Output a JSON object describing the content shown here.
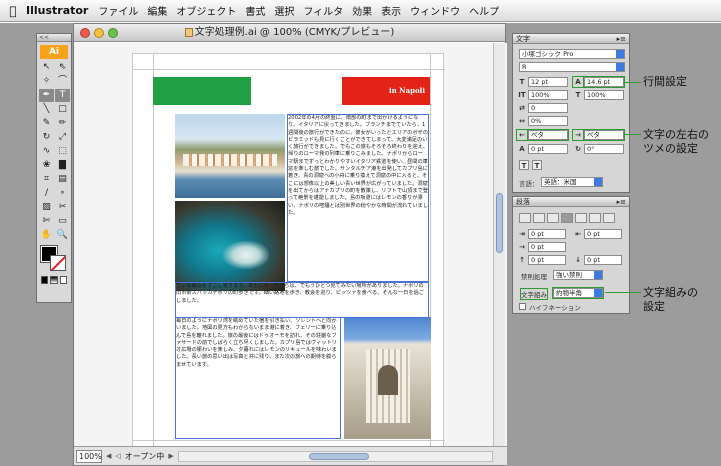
{
  "menubar": {
    "app_name": "Illustrator",
    "items": [
      "ファイル",
      "編集",
      "オブジェクト",
      "書式",
      "選択",
      "フィルタ",
      "効果",
      "表示",
      "ウィンドウ",
      "ヘルプ"
    ]
  },
  "tools_panel": {
    "collapse_label": "<<",
    "logo": "Ai"
  },
  "document": {
    "title": "文字処理例.ai @ 100% (CMYK/プレビュー)",
    "zoom": "100%",
    "status": "オープン中",
    "banner_text": "in Napoli",
    "text_block_1": "2002年の4月の終盤に、南部の町まで出かけるようになり、イタリアに戻ってきました。ブランチまでていたら、1週間後の旅行ができたのに、彼女がいったとエリアのボザのピラミッドも見に行くことができてしまって、大変満足のいく旅行ができました。でもこの旅もそろそろ終わりを迎え、帰りのローマ発の列車に乗りこみました。ナポリからローマ駅までずっとわかりやすいイタリア鉄道を使い、昼間の車窓を楽しむ旅でした。サンタルチア港を出発してカプリ島に着き、青の洞窟への小舟に乗り換えて洞窟の中に入ると、そこには想像以上の美しい青い世界が広がっていました。洞窟を出てからはアナカプリの町を散策し、リフトで山頂まで登って絶景を堪能しました。島の坂道にはレモンの香りが漂い、ナポリの喧騒とは別世界の穏やかな時間が流れていました。",
    "text_block_2": "ている最近をすこし書きます。本土に戻ってからは、でもうひとつ見てみたい場所がありました。ナポリの旧市街スパッカナポリの町歩きです。細い路地を歩き、教会を巡り、ピッツァを食べる、そんな一日を過ごしました。",
    "text_block_3": "毎日のようにナポリ湾を眺めていた宿を引き払い、ソレントへと向かいました。地図の見方もわからないまま港に着き、フェリーに乗り込んで島を離れました。旅の最後にはドゥオーモを訪れ、その荘厳なファサードの前でしばらく立ち尽くしました。カプリ島ではヴィットリオ広場の賑わいを楽しみ、夕暮れにはレモンのリキュールを味わいました。長い旅の思い出は写真と共に残り、また次の旅への期待を膨らませています。"
  },
  "character_panel": {
    "title": "文字",
    "font_family": "小塚ゴシック Pro",
    "font_style": "R",
    "font_size": "12 pt",
    "leading": "14.6 pt",
    "vertical_scale": "100%",
    "horizontal_scale": "100%",
    "tracking": "0",
    "kerning": "0%",
    "aki_left": "ベタ",
    "aki_right": "ベタ",
    "baseline_shift": "0 pt",
    "rotation": "0°",
    "language_label": "言語：",
    "language": "英語：米国"
  },
  "paragraph_panel": {
    "title": "段落",
    "indent_left": "0 pt",
    "indent_right": "0 pt",
    "first_line": "0 pt",
    "space_before": "0 pt",
    "space_after": "0 pt",
    "kinsoku_label": "禁則処理",
    "kinsoku": "強い禁則",
    "mojikumi_label": "文字組み",
    "mojikumi": "約物半角",
    "hyphenation": "ハイフネーション"
  },
  "annotations": {
    "leading": "行間設定",
    "tsume": "文字の左右の\nツメの設定",
    "mojikumi": "文字組みの\n設定"
  },
  "colors": {
    "highlight": "#2f9a2f",
    "flag_green": "#21a046",
    "flag_red": "#e22316",
    "selection": "#4a73d8"
  }
}
